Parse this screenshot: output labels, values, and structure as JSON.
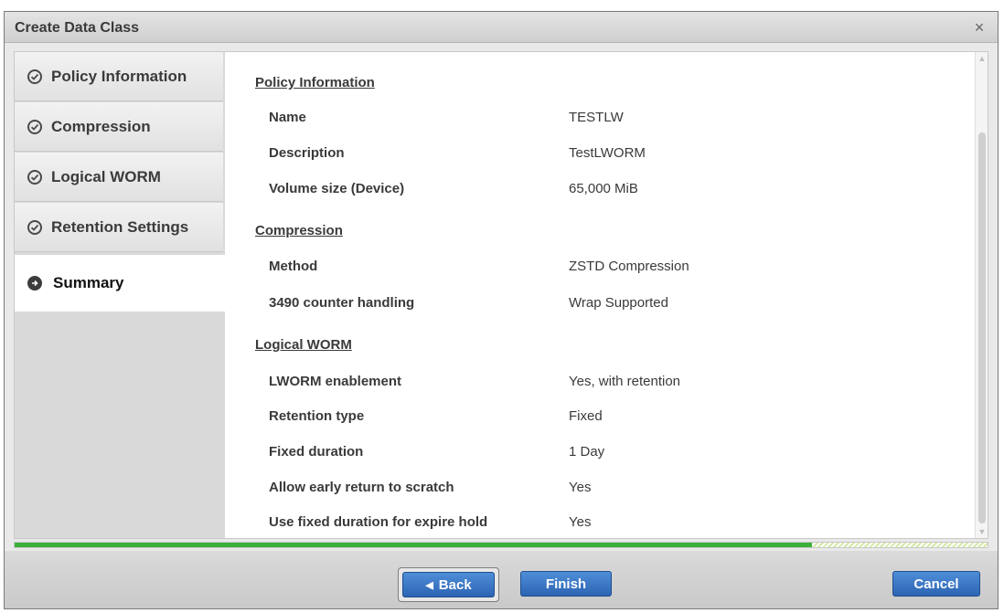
{
  "dialog": {
    "title": "Create Data Class",
    "close_label": "×"
  },
  "steps": [
    {
      "label": "Policy Information",
      "status": "done"
    },
    {
      "label": "Compression",
      "status": "done"
    },
    {
      "label": "Logical WORM",
      "status": "done"
    },
    {
      "label": "Retention Settings",
      "status": "done"
    },
    {
      "label": "Summary",
      "status": "active"
    }
  ],
  "summary": {
    "policy": {
      "title": "Policy Information",
      "rows": [
        {
          "label": "Name",
          "value": "TESTLW"
        },
        {
          "label": "Description",
          "value": "TestLWORM"
        },
        {
          "label": "Volume size (Device)",
          "value": "65,000 MiB"
        }
      ]
    },
    "compression": {
      "title": "Compression",
      "rows": [
        {
          "label": "Method",
          "value": "ZSTD Compression"
        },
        {
          "label": "3490 counter handling",
          "value": "Wrap Supported"
        }
      ]
    },
    "lworm": {
      "title": "Logical WORM",
      "rows": [
        {
          "label": "LWORM enablement",
          "value": "Yes, with retention"
        },
        {
          "label": "Retention type",
          "value": "Fixed"
        },
        {
          "label": "Fixed duration",
          "value": "1 Day"
        },
        {
          "label": "Allow early return to scratch",
          "value": "Yes"
        },
        {
          "label": "Use fixed duration for expire hold",
          "value": "Yes"
        }
      ]
    }
  },
  "progress": {
    "fraction": 0.82,
    "fill_color": "#3ab03a"
  },
  "footer": {
    "back_label": "Back",
    "finish_label": "Finish",
    "cancel_label": "Cancel"
  },
  "colors": {
    "button": "#3a78c8",
    "check": "#4a4a4a"
  }
}
